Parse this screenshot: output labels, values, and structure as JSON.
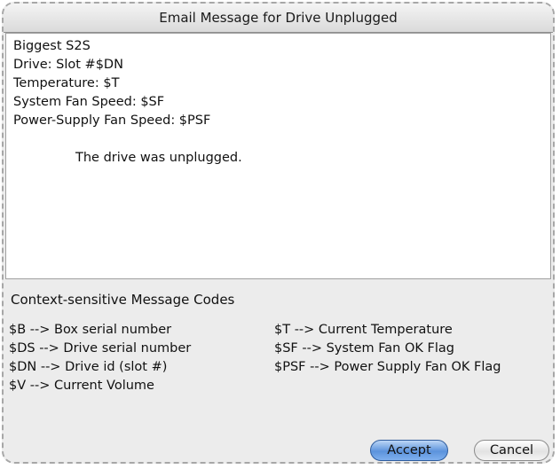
{
  "window": {
    "title": "Email Message for Drive Unplugged"
  },
  "message": {
    "lines": [
      "Biggest S2S",
      "Drive: Slot #$DN",
      "Temperature: $T",
      "System Fan Speed: $SF",
      "Power-Supply Fan Speed: $PSF"
    ],
    "body": "The drive was unplugged."
  },
  "codes": {
    "heading": "Context-sensitive Message Codes",
    "left": [
      "$B  --> Box serial number",
      "$DS --> Drive serial number",
      "$DN --> Drive id (slot #)",
      "$V  --> Current Volume"
    ],
    "right": [
      "$T   --> Current Temperature",
      "$SF  --> System Fan OK Flag",
      "$PSF --> Power Supply Fan OK Flag"
    ]
  },
  "buttons": {
    "accept": "Accept",
    "cancel": "Cancel"
  },
  "colors": {
    "dialog_bg": "#ececec",
    "accept_button": "#5c93dc",
    "border_dashed": "#a7a7a7"
  }
}
